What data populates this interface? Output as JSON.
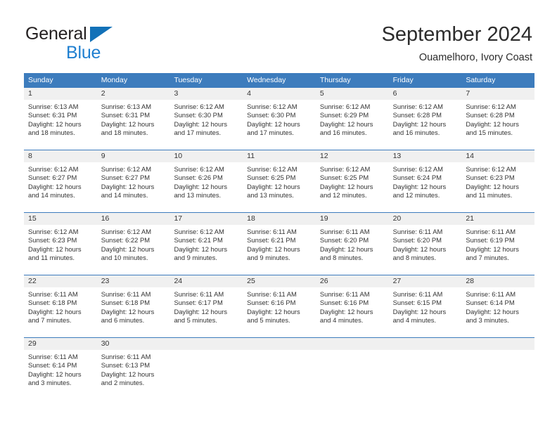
{
  "brand": {
    "name_part1": "General",
    "name_part2": "Blue",
    "triangle_color": "#1271b8",
    "blue_color": "#1f7fd0"
  },
  "header": {
    "title": "September 2024",
    "subtitle": "Ouamelhoro, Ivory Coast"
  },
  "theme": {
    "header_blue": "#3d7cbd",
    "daynum_band": "#f0f0f0",
    "text": "#333333"
  },
  "calendar": {
    "weekdays": [
      "Sunday",
      "Monday",
      "Tuesday",
      "Wednesday",
      "Thursday",
      "Friday",
      "Saturday"
    ],
    "weeks": [
      [
        {
          "day": "1",
          "sunrise": "Sunrise: 6:13 AM",
          "sunset": "Sunset: 6:31 PM",
          "daylight1": "Daylight: 12 hours",
          "daylight2": "and 18 minutes."
        },
        {
          "day": "2",
          "sunrise": "Sunrise: 6:13 AM",
          "sunset": "Sunset: 6:31 PM",
          "daylight1": "Daylight: 12 hours",
          "daylight2": "and 18 minutes."
        },
        {
          "day": "3",
          "sunrise": "Sunrise: 6:12 AM",
          "sunset": "Sunset: 6:30 PM",
          "daylight1": "Daylight: 12 hours",
          "daylight2": "and 17 minutes."
        },
        {
          "day": "4",
          "sunrise": "Sunrise: 6:12 AM",
          "sunset": "Sunset: 6:30 PM",
          "daylight1": "Daylight: 12 hours",
          "daylight2": "and 17 minutes."
        },
        {
          "day": "5",
          "sunrise": "Sunrise: 6:12 AM",
          "sunset": "Sunset: 6:29 PM",
          "daylight1": "Daylight: 12 hours",
          "daylight2": "and 16 minutes."
        },
        {
          "day": "6",
          "sunrise": "Sunrise: 6:12 AM",
          "sunset": "Sunset: 6:28 PM",
          "daylight1": "Daylight: 12 hours",
          "daylight2": "and 16 minutes."
        },
        {
          "day": "7",
          "sunrise": "Sunrise: 6:12 AM",
          "sunset": "Sunset: 6:28 PM",
          "daylight1": "Daylight: 12 hours",
          "daylight2": "and 15 minutes."
        }
      ],
      [
        {
          "day": "8",
          "sunrise": "Sunrise: 6:12 AM",
          "sunset": "Sunset: 6:27 PM",
          "daylight1": "Daylight: 12 hours",
          "daylight2": "and 14 minutes."
        },
        {
          "day": "9",
          "sunrise": "Sunrise: 6:12 AM",
          "sunset": "Sunset: 6:27 PM",
          "daylight1": "Daylight: 12 hours",
          "daylight2": "and 14 minutes."
        },
        {
          "day": "10",
          "sunrise": "Sunrise: 6:12 AM",
          "sunset": "Sunset: 6:26 PM",
          "daylight1": "Daylight: 12 hours",
          "daylight2": "and 13 minutes."
        },
        {
          "day": "11",
          "sunrise": "Sunrise: 6:12 AM",
          "sunset": "Sunset: 6:25 PM",
          "daylight1": "Daylight: 12 hours",
          "daylight2": "and 13 minutes."
        },
        {
          "day": "12",
          "sunrise": "Sunrise: 6:12 AM",
          "sunset": "Sunset: 6:25 PM",
          "daylight1": "Daylight: 12 hours",
          "daylight2": "and 12 minutes."
        },
        {
          "day": "13",
          "sunrise": "Sunrise: 6:12 AM",
          "sunset": "Sunset: 6:24 PM",
          "daylight1": "Daylight: 12 hours",
          "daylight2": "and 12 minutes."
        },
        {
          "day": "14",
          "sunrise": "Sunrise: 6:12 AM",
          "sunset": "Sunset: 6:23 PM",
          "daylight1": "Daylight: 12 hours",
          "daylight2": "and 11 minutes."
        }
      ],
      [
        {
          "day": "15",
          "sunrise": "Sunrise: 6:12 AM",
          "sunset": "Sunset: 6:23 PM",
          "daylight1": "Daylight: 12 hours",
          "daylight2": "and 11 minutes."
        },
        {
          "day": "16",
          "sunrise": "Sunrise: 6:12 AM",
          "sunset": "Sunset: 6:22 PM",
          "daylight1": "Daylight: 12 hours",
          "daylight2": "and 10 minutes."
        },
        {
          "day": "17",
          "sunrise": "Sunrise: 6:12 AM",
          "sunset": "Sunset: 6:21 PM",
          "daylight1": "Daylight: 12 hours",
          "daylight2": "and 9 minutes."
        },
        {
          "day": "18",
          "sunrise": "Sunrise: 6:11 AM",
          "sunset": "Sunset: 6:21 PM",
          "daylight1": "Daylight: 12 hours",
          "daylight2": "and 9 minutes."
        },
        {
          "day": "19",
          "sunrise": "Sunrise: 6:11 AM",
          "sunset": "Sunset: 6:20 PM",
          "daylight1": "Daylight: 12 hours",
          "daylight2": "and 8 minutes."
        },
        {
          "day": "20",
          "sunrise": "Sunrise: 6:11 AM",
          "sunset": "Sunset: 6:20 PM",
          "daylight1": "Daylight: 12 hours",
          "daylight2": "and 8 minutes."
        },
        {
          "day": "21",
          "sunrise": "Sunrise: 6:11 AM",
          "sunset": "Sunset: 6:19 PM",
          "daylight1": "Daylight: 12 hours",
          "daylight2": "and 7 minutes."
        }
      ],
      [
        {
          "day": "22",
          "sunrise": "Sunrise: 6:11 AM",
          "sunset": "Sunset: 6:18 PM",
          "daylight1": "Daylight: 12 hours",
          "daylight2": "and 7 minutes."
        },
        {
          "day": "23",
          "sunrise": "Sunrise: 6:11 AM",
          "sunset": "Sunset: 6:18 PM",
          "daylight1": "Daylight: 12 hours",
          "daylight2": "and 6 minutes."
        },
        {
          "day": "24",
          "sunrise": "Sunrise: 6:11 AM",
          "sunset": "Sunset: 6:17 PM",
          "daylight1": "Daylight: 12 hours",
          "daylight2": "and 5 minutes."
        },
        {
          "day": "25",
          "sunrise": "Sunrise: 6:11 AM",
          "sunset": "Sunset: 6:16 PM",
          "daylight1": "Daylight: 12 hours",
          "daylight2": "and 5 minutes."
        },
        {
          "day": "26",
          "sunrise": "Sunrise: 6:11 AM",
          "sunset": "Sunset: 6:16 PM",
          "daylight1": "Daylight: 12 hours",
          "daylight2": "and 4 minutes."
        },
        {
          "day": "27",
          "sunrise": "Sunrise: 6:11 AM",
          "sunset": "Sunset: 6:15 PM",
          "daylight1": "Daylight: 12 hours",
          "daylight2": "and 4 minutes."
        },
        {
          "day": "28",
          "sunrise": "Sunrise: 6:11 AM",
          "sunset": "Sunset: 6:14 PM",
          "daylight1": "Daylight: 12 hours",
          "daylight2": "and 3 minutes."
        }
      ],
      [
        {
          "day": "29",
          "sunrise": "Sunrise: 6:11 AM",
          "sunset": "Sunset: 6:14 PM",
          "daylight1": "Daylight: 12 hours",
          "daylight2": "and 3 minutes."
        },
        {
          "day": "30",
          "sunrise": "Sunrise: 6:11 AM",
          "sunset": "Sunset: 6:13 PM",
          "daylight1": "Daylight: 12 hours",
          "daylight2": "and 2 minutes."
        },
        {
          "day": "",
          "sunrise": "",
          "sunset": "",
          "daylight1": "",
          "daylight2": ""
        },
        {
          "day": "",
          "sunrise": "",
          "sunset": "",
          "daylight1": "",
          "daylight2": ""
        },
        {
          "day": "",
          "sunrise": "",
          "sunset": "",
          "daylight1": "",
          "daylight2": ""
        },
        {
          "day": "",
          "sunrise": "",
          "sunset": "",
          "daylight1": "",
          "daylight2": ""
        },
        {
          "day": "",
          "sunrise": "",
          "sunset": "",
          "daylight1": "",
          "daylight2": ""
        }
      ]
    ]
  }
}
